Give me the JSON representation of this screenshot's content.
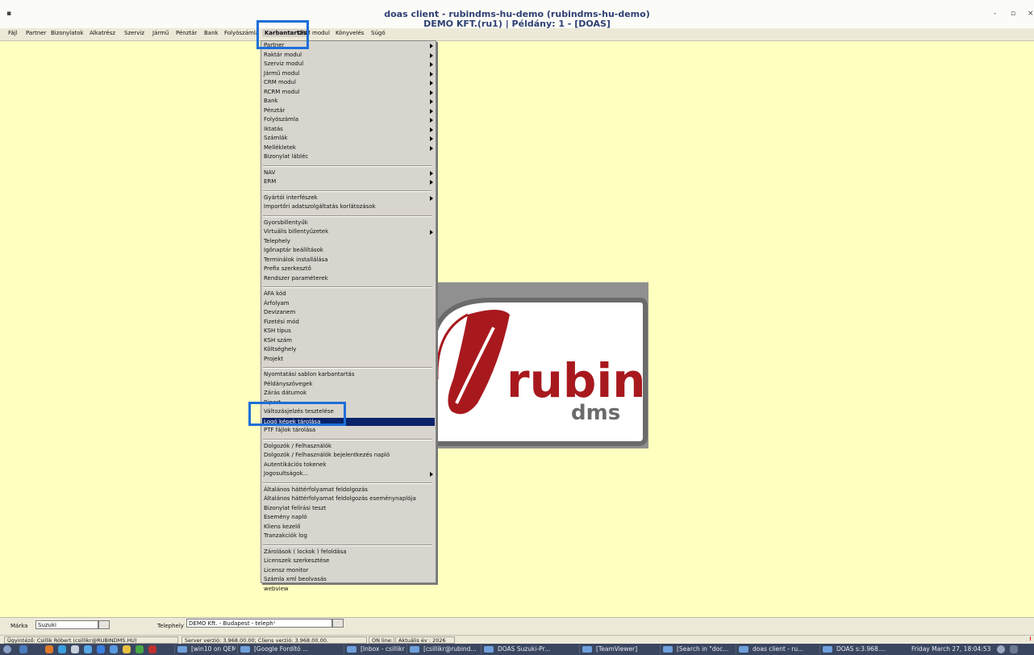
{
  "window": {
    "title_line1": "doas client - rubindms-hu-demo (rubindms-hu-demo)",
    "title_line2": "DEMO KFT.(ru1) | Példány: 1 - [DOAS]",
    "controls": {
      "menu": "▪",
      "minimize": "-",
      "maximize": "▫",
      "close": "×"
    }
  },
  "menubar": {
    "items": [
      "Fájl",
      "Partner",
      "Bizonylatok",
      "Alkatrész",
      "Szerviz",
      "Jármű",
      "Pénztár",
      "Bank",
      "Folyószámla",
      "Karbantartás",
      "CRM modul",
      "Könyvelés",
      "Súgó"
    ],
    "active": "Karbantartás"
  },
  "dropdown": {
    "groups": [
      [
        {
          "label": "Partner",
          "submenu": true
        },
        {
          "label": "Raktár modul",
          "submenu": true
        },
        {
          "label": "Szerviz modul",
          "submenu": true
        },
        {
          "label": "Jármű modul",
          "submenu": true
        },
        {
          "label": "CRM modul",
          "submenu": true
        },
        {
          "label": "RCRM modul",
          "submenu": true
        },
        {
          "label": "Bank",
          "submenu": true
        },
        {
          "label": "Pénztár",
          "submenu": true
        },
        {
          "label": "Folyószámla",
          "submenu": true
        },
        {
          "label": "Iktatás",
          "submenu": true
        },
        {
          "label": "Számlák",
          "submenu": true
        },
        {
          "label": "Mellékletek",
          "submenu": true
        },
        {
          "label": "Bizonylat lábléc",
          "submenu": false
        }
      ],
      [
        {
          "label": "NAV",
          "submenu": true
        },
        {
          "label": "ERM",
          "submenu": true
        }
      ],
      [
        {
          "label": "Gyártói interfészek",
          "submenu": true
        },
        {
          "label": "Importőri adatszolgáltatás korlátozások",
          "submenu": false
        }
      ],
      [
        {
          "label": "Gyorsbillentyűk",
          "submenu": false
        },
        {
          "label": "Virtuális billentyűzetek",
          "submenu": true
        },
        {
          "label": "Telephely",
          "submenu": false
        },
        {
          "label": "Igőnaptár beállítások",
          "submenu": false
        },
        {
          "label": "Terminálok installálása",
          "submenu": false
        },
        {
          "label": "Prefix szerkesztő",
          "submenu": false
        },
        {
          "label": "Rendszer paraméterek",
          "submenu": false
        }
      ],
      [
        {
          "label": "ÁFA kód",
          "submenu": false
        },
        {
          "label": "Árfolyam",
          "submenu": false
        },
        {
          "label": "Devizanem",
          "submenu": false
        },
        {
          "label": "Fizetési mód",
          "submenu": false
        },
        {
          "label": "KSH típus",
          "submenu": false
        },
        {
          "label": "KSH szám",
          "submenu": false
        },
        {
          "label": "Költséghely",
          "submenu": false
        },
        {
          "label": "Projekt",
          "submenu": false
        }
      ],
      [
        {
          "label": "Nyomtatási sablon karbantartás",
          "submenu": false
        },
        {
          "label": "Példányszövegek",
          "submenu": false
        },
        {
          "label": "Zárás dátumok",
          "submenu": false
        },
        {
          "label": "Riport",
          "submenu": false
        },
        {
          "label": "Változásjelzés tesztelése",
          "submenu": false
        },
        {
          "label": "Logó képek tárolása",
          "submenu": false,
          "selected": true
        },
        {
          "label": "PTF fájlok tárolása",
          "submenu": false
        }
      ],
      [
        {
          "label": "Dolgozók / Felhasználók",
          "submenu": false
        },
        {
          "label": "Dolgozók / Felhasználók bejelentkezés napló",
          "submenu": false
        },
        {
          "label": "Autentikációs tokenek",
          "submenu": false
        },
        {
          "label": "Jogosultságok...",
          "submenu": true
        }
      ],
      [
        {
          "label": "Általános háttérfolyamat feldolgozás",
          "submenu": false
        },
        {
          "label": "Általános háttérfolyamat feldolgozás eseménynaplója",
          "submenu": false
        },
        {
          "label": "Bizonylat felírási teszt",
          "submenu": false
        },
        {
          "label": "Esemény napló",
          "submenu": false
        },
        {
          "label": "Kliens kezelő",
          "submenu": false
        },
        {
          "label": "Tranzakciók log",
          "submenu": false
        }
      ],
      [
        {
          "label": "Zárolások ( lockok ) feloldása",
          "submenu": false
        },
        {
          "label": "Licenszek szerkesztése",
          "submenu": false
        },
        {
          "label": "Licensz monitor",
          "submenu": false
        },
        {
          "label": "Számla xml beolvasás",
          "submenu": false
        },
        {
          "label": "webview",
          "submenu": false
        }
      ]
    ]
  },
  "logo": {
    "word1": "rubin",
    "word2": "dms",
    "colors": {
      "red": "#a8191e",
      "panel": "#909090",
      "card": "#ffffff"
    }
  },
  "bottom": {
    "marka_label": "Márka",
    "marka_value": "Suzuki",
    "telephely_label": "Telephely",
    "telephely_value": "DEMO Kft. - Budapest - telephˢ"
  },
  "status": {
    "user": "Ügyintéző: Csillik Róbert (csillikr@RUBINDMS.HU)",
    "version": "Server verzió: 3.968.00.00; Cliens verzió: 3.968.00.00.",
    "online": "ON line:",
    "year": "Aktuális év : 2026",
    "alert": "!"
  },
  "taskbar": {
    "buttons": [
      "[win10 on QEM...",
      "[Google Fordító ...",
      "[Inbox - csillikr...",
      "[csillikr@rubind...",
      "DOAS Suzuki-Pr...",
      "[TeamViewer]",
      "[Search in \"doc...",
      "doas client - ru...",
      "DOAS s:3.968...."
    ],
    "clock": "Friday March 27, 18:04:53"
  },
  "accent_colors": {
    "highlight_box": "#1e6fd9",
    "selection": "#0a246a",
    "workspace": "#ffffc0"
  }
}
